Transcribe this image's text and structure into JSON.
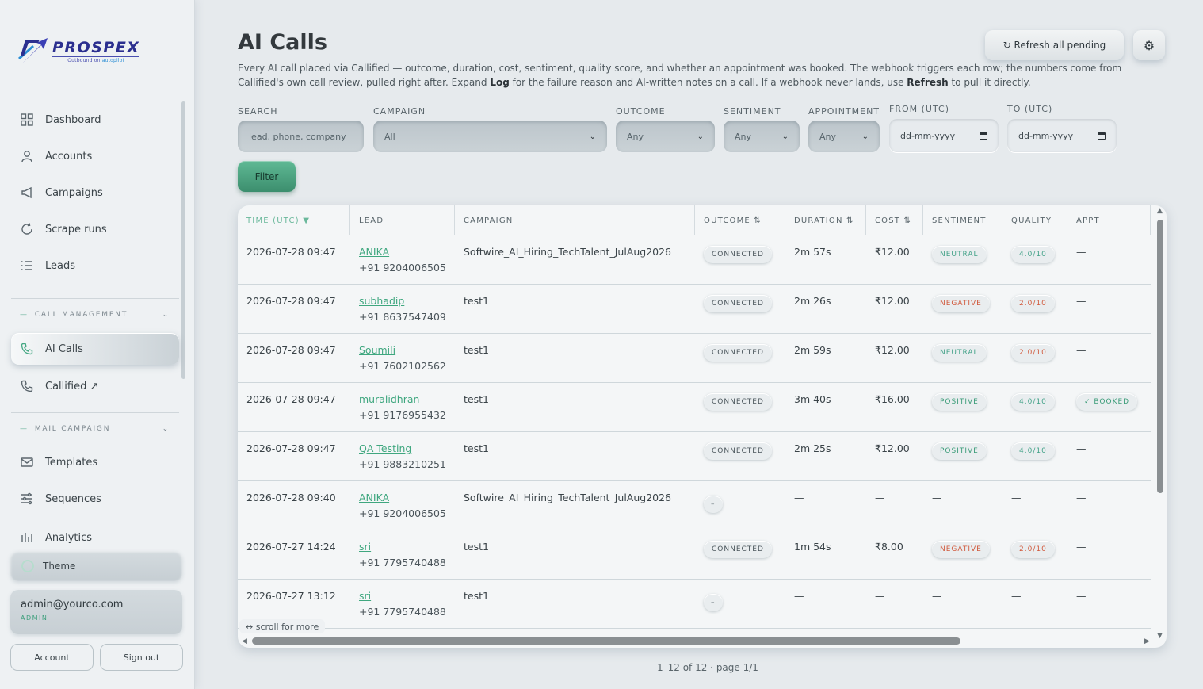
{
  "brand": {
    "name": "PROSPEX",
    "tagline_pre": "Outbound on ",
    "tagline_accent": "autopilot"
  },
  "sidebar": {
    "items": [
      {
        "label": "Dashboard",
        "icon": "grid-icon"
      },
      {
        "label": "Accounts",
        "icon": "user-icon"
      },
      {
        "label": "Campaigns",
        "icon": "megaphone-icon"
      },
      {
        "label": "Scrape runs",
        "icon": "refresh-icon"
      },
      {
        "label": "Leads",
        "icon": "list-icon"
      }
    ],
    "call_section": {
      "title": "CALL MANAGEMENT",
      "items": [
        {
          "label": "AI Calls",
          "icon": "phone-icon",
          "active": true
        },
        {
          "label": "Callified ↗",
          "icon": "phone-icon"
        }
      ]
    },
    "mail_section": {
      "title": "MAIL CAMPAIGN",
      "items": [
        {
          "label": "Templates",
          "icon": "mail-icon"
        },
        {
          "label": "Sequences",
          "icon": "sliders-icon"
        },
        {
          "label": "Analytics",
          "icon": "bar-chart-icon"
        }
      ]
    },
    "theme_label": "Theme",
    "user": {
      "email": "admin@yourco.com",
      "role": "ADMIN"
    },
    "account_btn": "Account",
    "signout_btn": "Sign out"
  },
  "header": {
    "title": "AI Calls",
    "desc_1": "Every AI call placed via Callified — outcome, duration, cost, sentiment, quality score, and whether an appointment was booked. The webhook triggers each row; the numbers come from Callified's own call review, pulled right after. Expand ",
    "desc_log": "Log",
    "desc_2": " for the failure reason and AI-written notes on a call. If a webhook never lands, use ",
    "desc_refresh": "Refresh",
    "desc_3": " to pull it directly.",
    "refresh_btn": "↻ Refresh all pending",
    "settings_icon": "gear-icon"
  },
  "filters": {
    "search_label": "SEARCH",
    "search_placeholder": "lead, phone, company",
    "campaign_label": "CAMPAIGN",
    "campaign_value": "All",
    "outcome_label": "OUTCOME",
    "outcome_value": "Any",
    "sentiment_label": "SENTIMENT",
    "sentiment_value": "Any",
    "appointment_label": "APPOINTMENT",
    "appointment_value": "Any",
    "from_label": "FROM (UTC)",
    "from_value": "dd-mm-yyyy",
    "to_label": "TO (UTC)",
    "to_value": "dd-mm-yyyy",
    "filter_btn": "Filter"
  },
  "table": {
    "columns": {
      "time": "TIME (UTC) ▼",
      "lead": "LEAD",
      "campaign": "CAMPAIGN",
      "outcome": "OUTCOME ⇅",
      "duration": "DURATION ⇅",
      "cost": "COST ⇅",
      "sentiment": "SENTIMENT",
      "quality": "QUALITY",
      "appt": "APPT"
    },
    "rows": [
      {
        "time": "2026-07-28 09:47",
        "lead": "ANIKA",
        "phone": "+91 9204006505",
        "campaign": "Softwire_AI_Hiring_TechTalent_JulAug2026",
        "outcome": "CONNECTED",
        "duration": "2m 57s",
        "cost": "₹12.00",
        "sentiment": "NEUTRAL",
        "quality": "4.0/10",
        "appt": "—"
      },
      {
        "time": "2026-07-28 09:47",
        "lead": "subhadip",
        "phone": "+91 8637547409",
        "campaign": "test1",
        "outcome": "CONNECTED",
        "duration": "2m 26s",
        "cost": "₹12.00",
        "sentiment": "NEGATIVE",
        "quality": "2.0/10",
        "appt": "—"
      },
      {
        "time": "2026-07-28 09:47",
        "lead": "Soumili",
        "phone": "+91 7602102562",
        "campaign": "test1",
        "outcome": "CONNECTED",
        "duration": "2m 59s",
        "cost": "₹12.00",
        "sentiment": "NEUTRAL",
        "quality": "2.0/10",
        "appt": "—"
      },
      {
        "time": "2026-07-28 09:47",
        "lead": "muralidhran",
        "phone": "+91 9176955432",
        "campaign": "test1",
        "outcome": "CONNECTED",
        "duration": "3m 40s",
        "cost": "₹16.00",
        "sentiment": "POSITIVE",
        "quality": "4.0/10",
        "appt": "✓ BOOKED"
      },
      {
        "time": "2026-07-28 09:47",
        "lead": "QA Testing",
        "phone": "+91 9883210251",
        "campaign": "test1",
        "outcome": "CONNECTED",
        "duration": "2m 25s",
        "cost": "₹12.00",
        "sentiment": "POSITIVE",
        "quality": "4.0/10",
        "appt": "—"
      },
      {
        "time": "2026-07-28 09:40",
        "lead": "ANIKA",
        "phone": "+91 9204006505",
        "campaign": "Softwire_AI_Hiring_TechTalent_JulAug2026",
        "outcome": "–",
        "duration": "—",
        "cost": "—",
        "sentiment": "—",
        "quality": "—",
        "appt": "—"
      },
      {
        "time": "2026-07-27 14:24",
        "lead": "sri",
        "phone": "+91 7795740488",
        "campaign": "test1",
        "outcome": "CONNECTED",
        "duration": "1m 54s",
        "cost": "₹8.00",
        "sentiment": "NEGATIVE",
        "quality": "2.0/10",
        "appt": "—"
      },
      {
        "time": "2026-07-27 13:12",
        "lead": "sri",
        "phone": "+91 7795740488",
        "campaign": "test1",
        "outcome": "–",
        "duration": "—",
        "cost": "—",
        "sentiment": "—",
        "quality": "—",
        "appt": "—"
      }
    ],
    "scroll_hint": "↔ scroll for more"
  },
  "pager": "1–12 of 12 · page 1/1",
  "colors": {
    "accent": "#46a884",
    "negative": "#d15a3d",
    "brand": "#2b2f8f"
  }
}
